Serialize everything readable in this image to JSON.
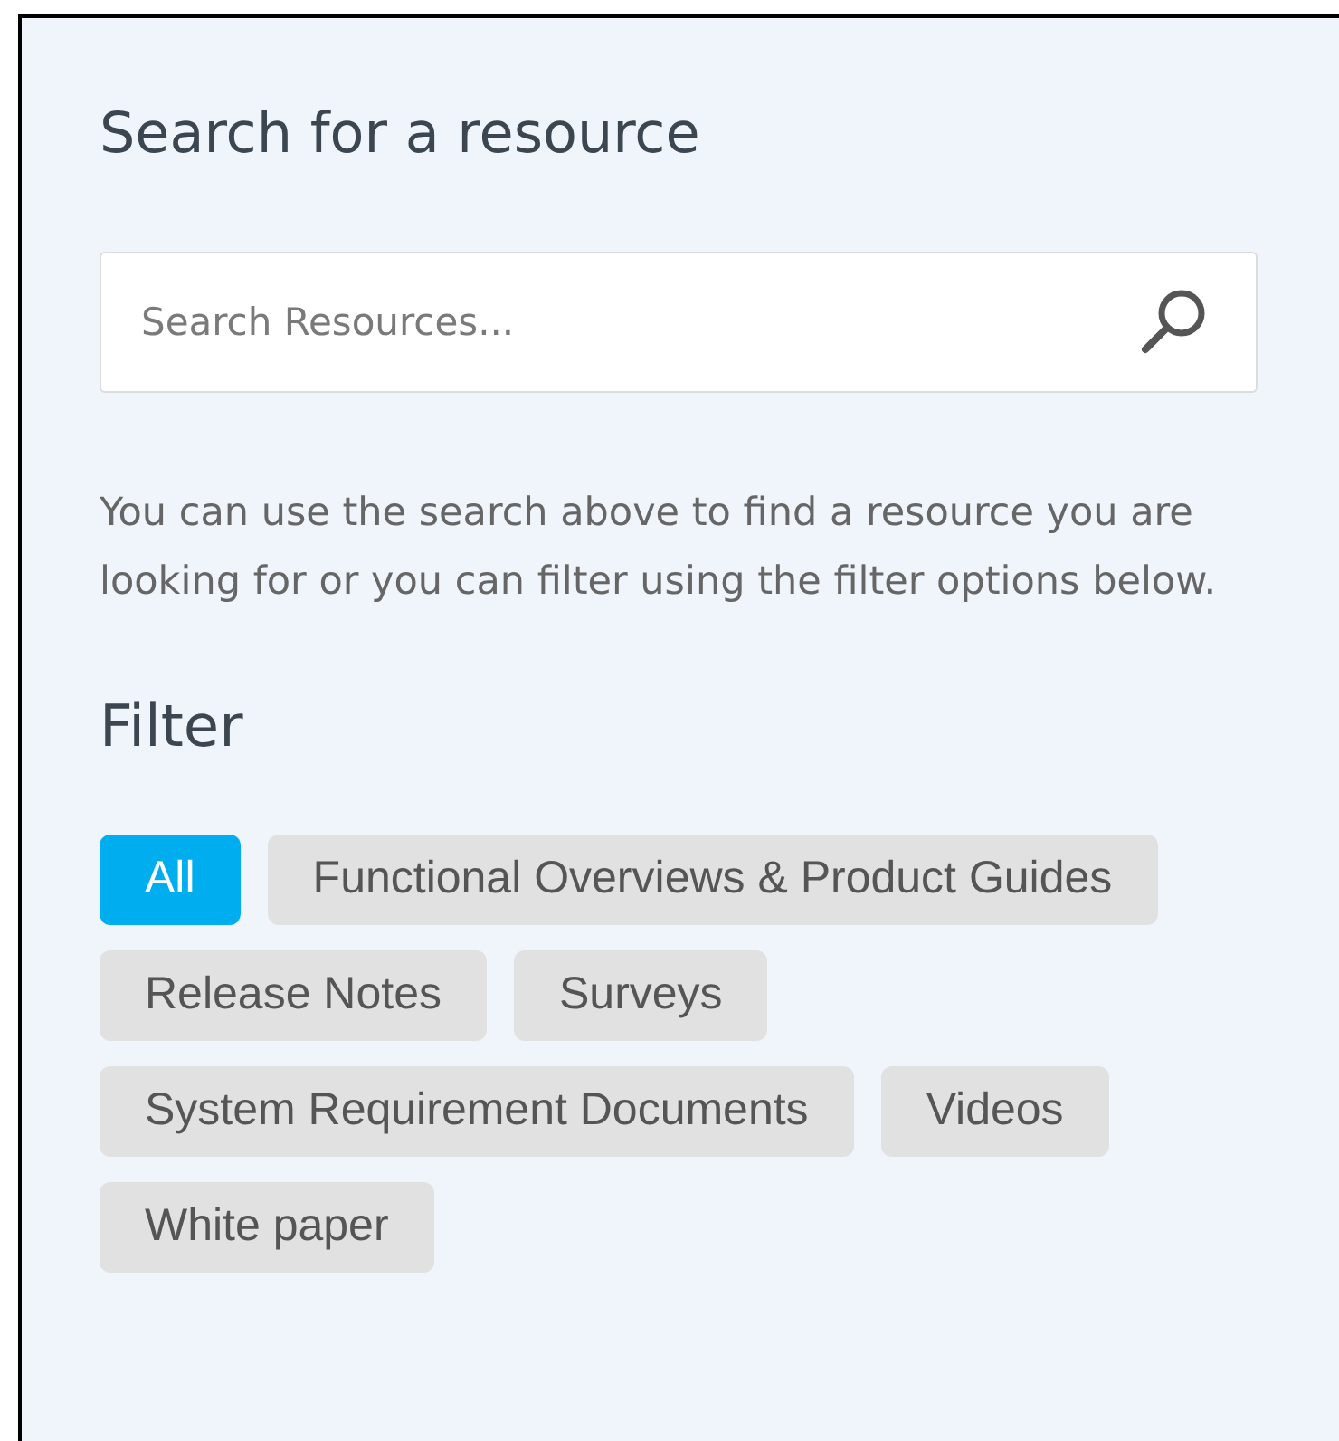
{
  "title": "Search for a resource",
  "search": {
    "placeholder": "Search Resources..."
  },
  "description": "You can use the search above to find a resource you are looking for or you can filter using the filter options below.",
  "filter": {
    "heading": "Filter",
    "options": [
      {
        "label": "All",
        "selected": true
      },
      {
        "label": "Functional Overviews & Product Guides",
        "selected": false
      },
      {
        "label": "Release Notes",
        "selected": false
      },
      {
        "label": "Surveys",
        "selected": false
      },
      {
        "label": "System Requirement Documents",
        "selected": false
      },
      {
        "label": "Videos",
        "selected": false
      },
      {
        "label": "White paper",
        "selected": false
      }
    ]
  }
}
